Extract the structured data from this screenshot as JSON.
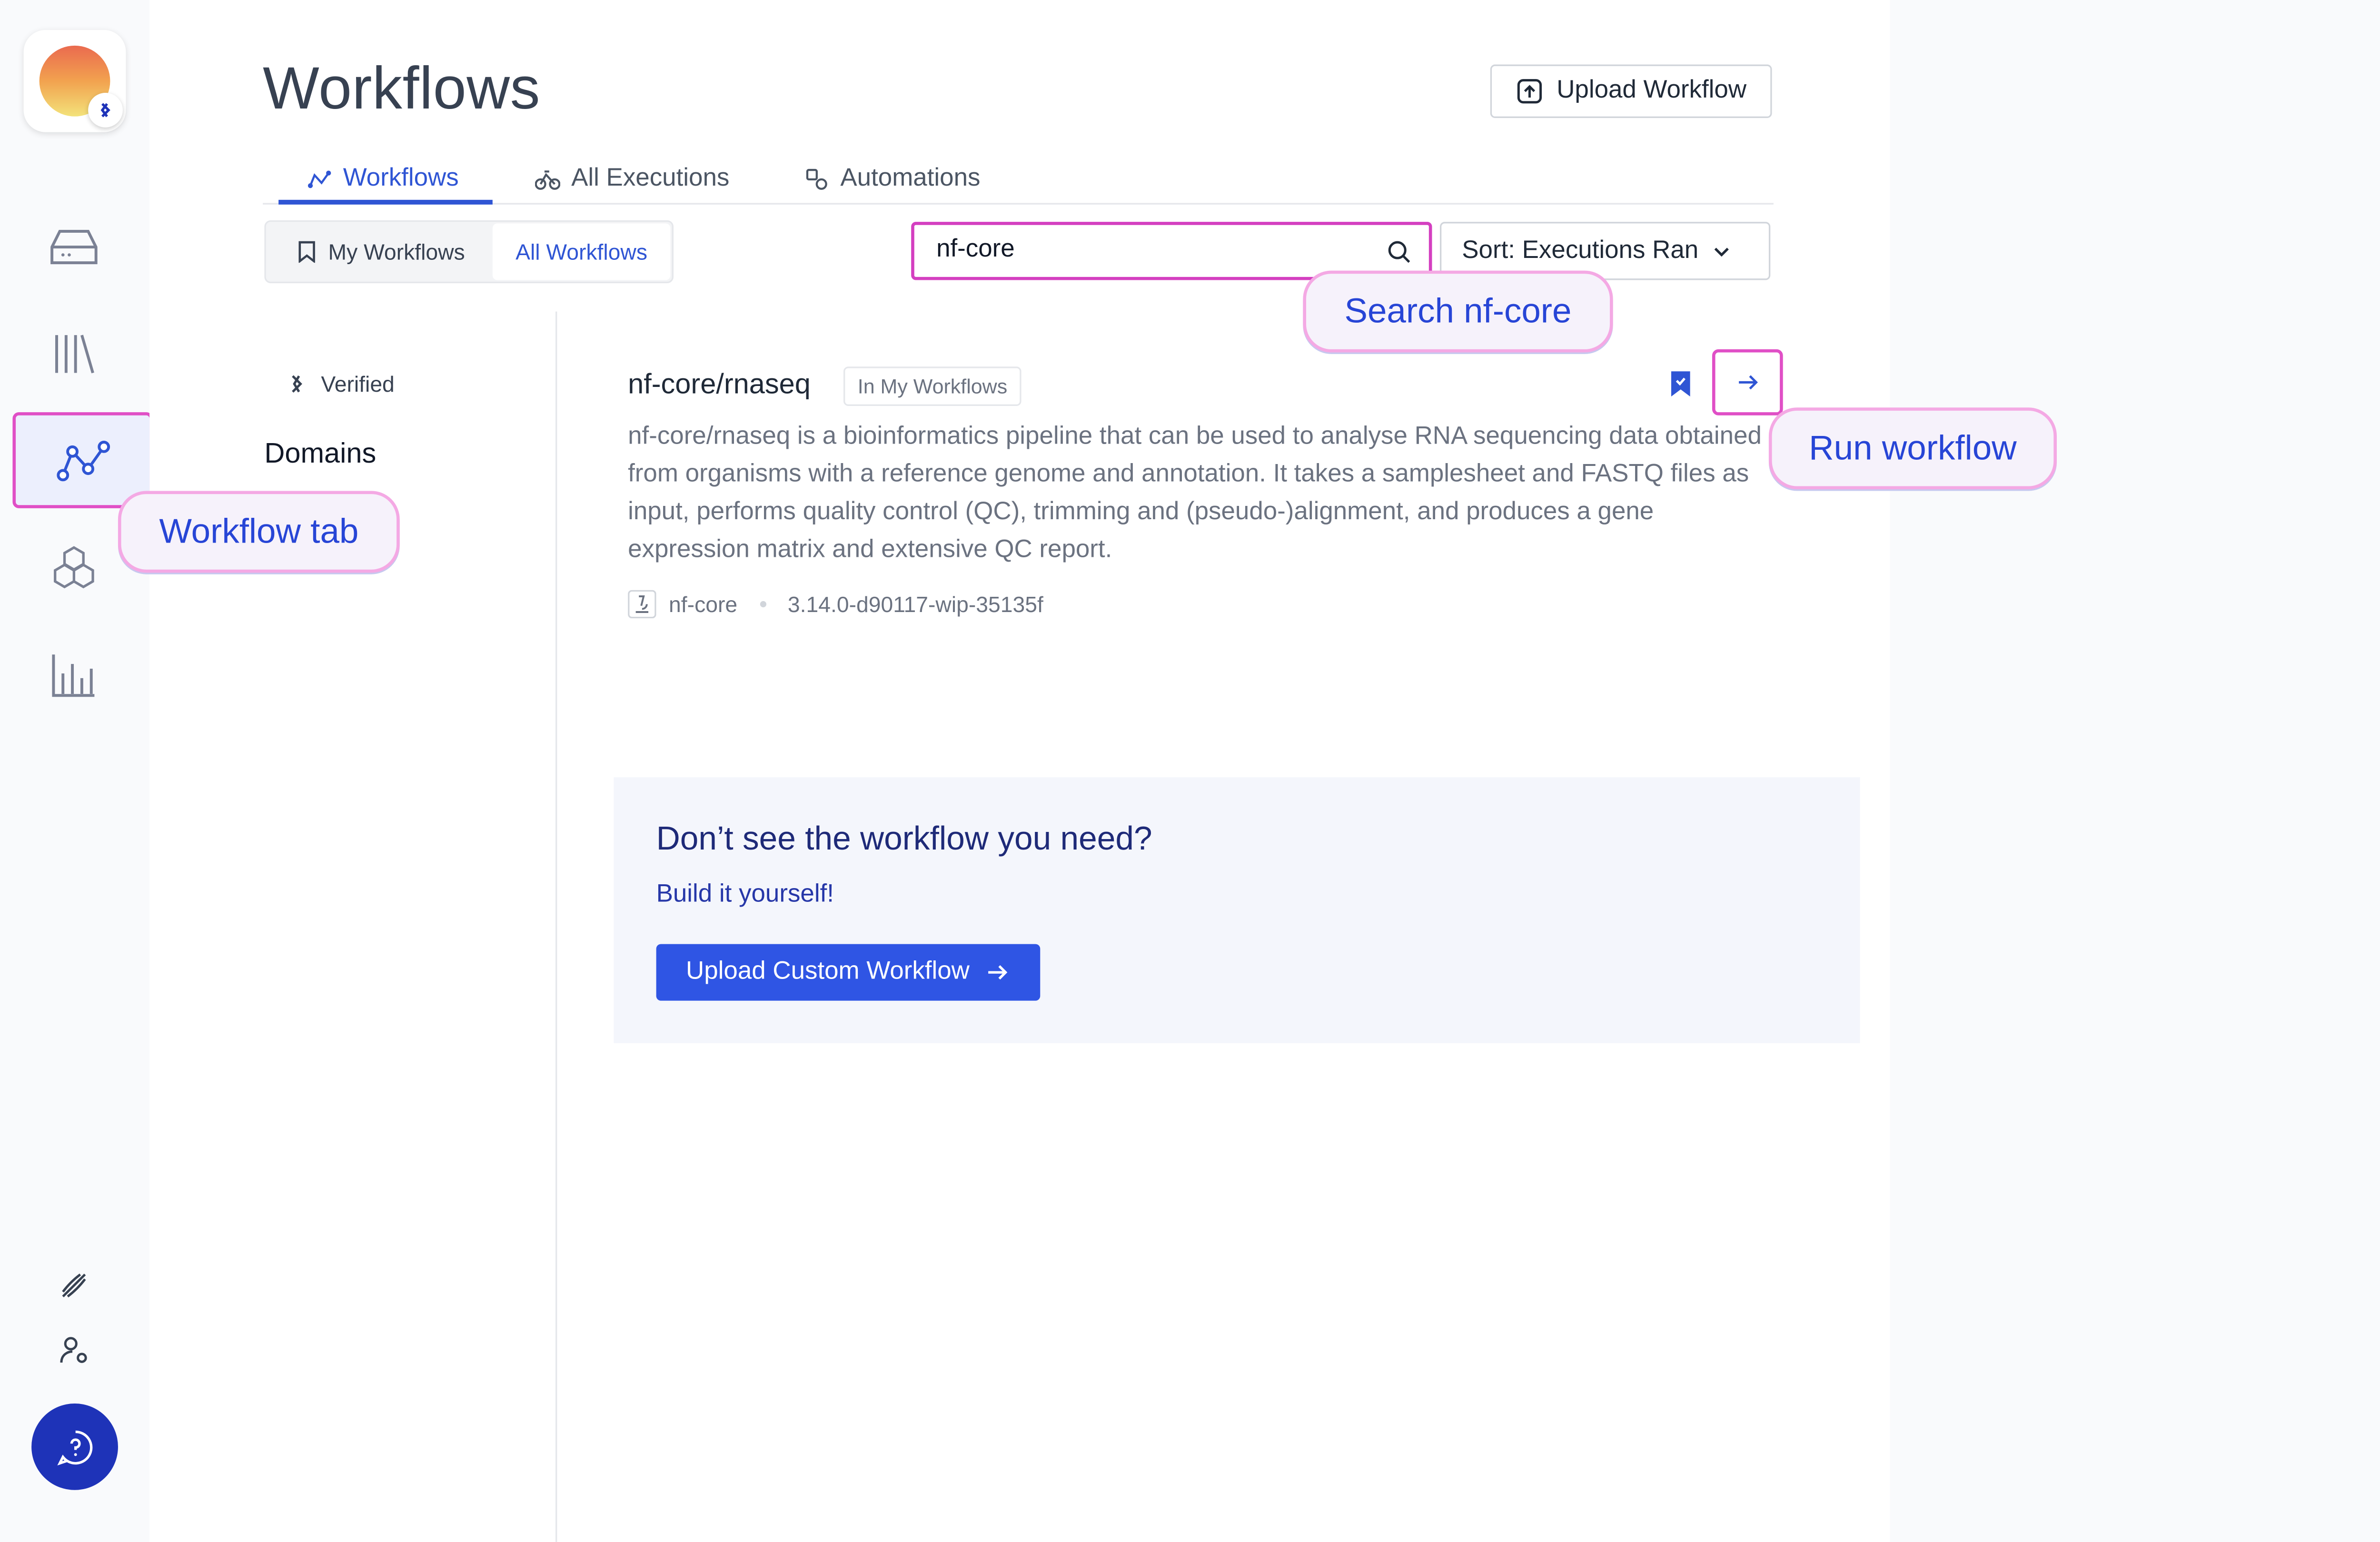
{
  "sidebar": {
    "items": [
      {
        "icon": "drive-icon"
      },
      {
        "icon": "library-icon"
      },
      {
        "icon": "workflow-icon",
        "active": true
      },
      {
        "icon": "hexagons-icon"
      },
      {
        "icon": "bar-chart-icon"
      }
    ],
    "bottom": [
      {
        "icon": "dna-icon"
      },
      {
        "icon": "user-settings-icon"
      },
      {
        "icon": "help-chat-icon"
      }
    ]
  },
  "header": {
    "title": "Workflows",
    "upload_label": "Upload Workflow"
  },
  "tabs": [
    {
      "label": "Workflows",
      "icon": "workflow-icon",
      "active": true
    },
    {
      "label": "All Executions",
      "icon": "bike-icon"
    },
    {
      "label": "Automations",
      "icon": "automation-icon"
    }
  ],
  "filter": {
    "my_label": "My Workflows",
    "all_label": "All Workflows",
    "selected": "All Workflows"
  },
  "search": {
    "value": "nf-core"
  },
  "sort": {
    "label": "Sort: Executions Ran"
  },
  "facets": {
    "verified_label": "Verified",
    "domains_label": "Domains"
  },
  "workflow": {
    "title": "nf-core/rnaseq",
    "chip": "In My Workflows",
    "description": "nf-core/rnaseq is a bioinformatics pipeline that can be used to analyse RNA sequencing data obtained from organisms with a reference genome and annotation. It takes a samplesheet and FASTQ files as input, performs quality control (QC), trimming and (pseudo-)alignment, and produces a gene expression matrix and extensive QC report.",
    "author": "nf-core",
    "version": "3.14.0-d90117-wip-35135f"
  },
  "cta": {
    "heading": "Don’t see the workflow you need?",
    "sub": "Build it yourself!",
    "button": "Upload Custom Workflow"
  },
  "callouts": {
    "workflow_tab": "Workflow tab",
    "search": "Search nf-core",
    "run": "Run workflow"
  },
  "colors": {
    "accent": "#2f55d4",
    "highlight": "#e04fc6",
    "cta_button": "#2f55e4"
  }
}
